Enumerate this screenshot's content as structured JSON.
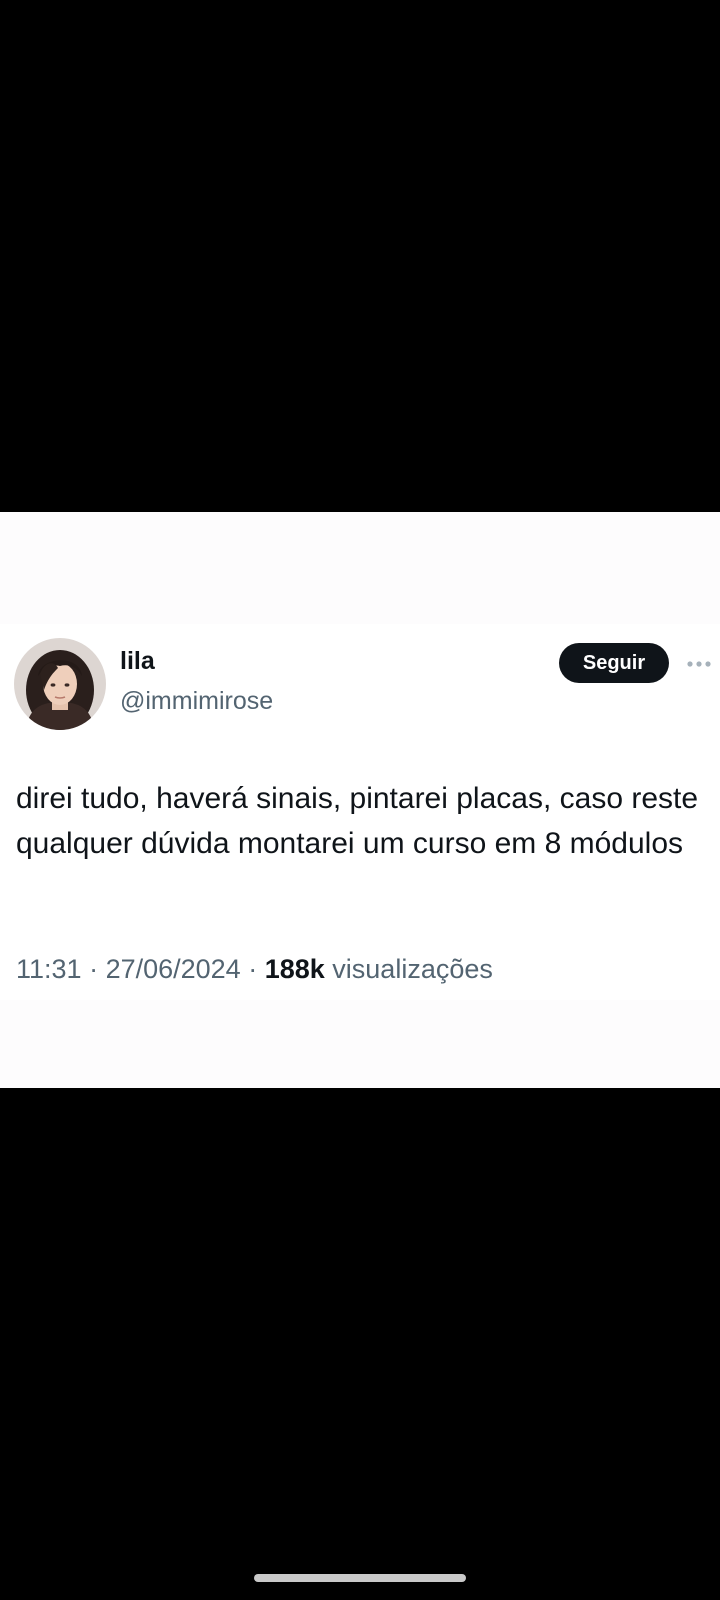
{
  "tweet": {
    "author": {
      "display_name": "lila",
      "handle": "@immimirose",
      "avatar_icon": "profile-photo"
    },
    "follow_label": "Seguir",
    "more_icon": "more-horizontal-icon",
    "text": "direi tudo, haverá sinais, pintarei placas, caso reste qualquer dúvida montarei um curso em 8 módulos",
    "meta": {
      "time": "11:31",
      "separator": " · ",
      "date": "27/06/2024",
      "views_count": "188k",
      "views_label": "visualizações"
    }
  },
  "colors": {
    "background": "#000000",
    "card": "#ffffff",
    "text_primary": "#0f1419",
    "text_secondary": "#536471",
    "button": "#0f1419"
  }
}
